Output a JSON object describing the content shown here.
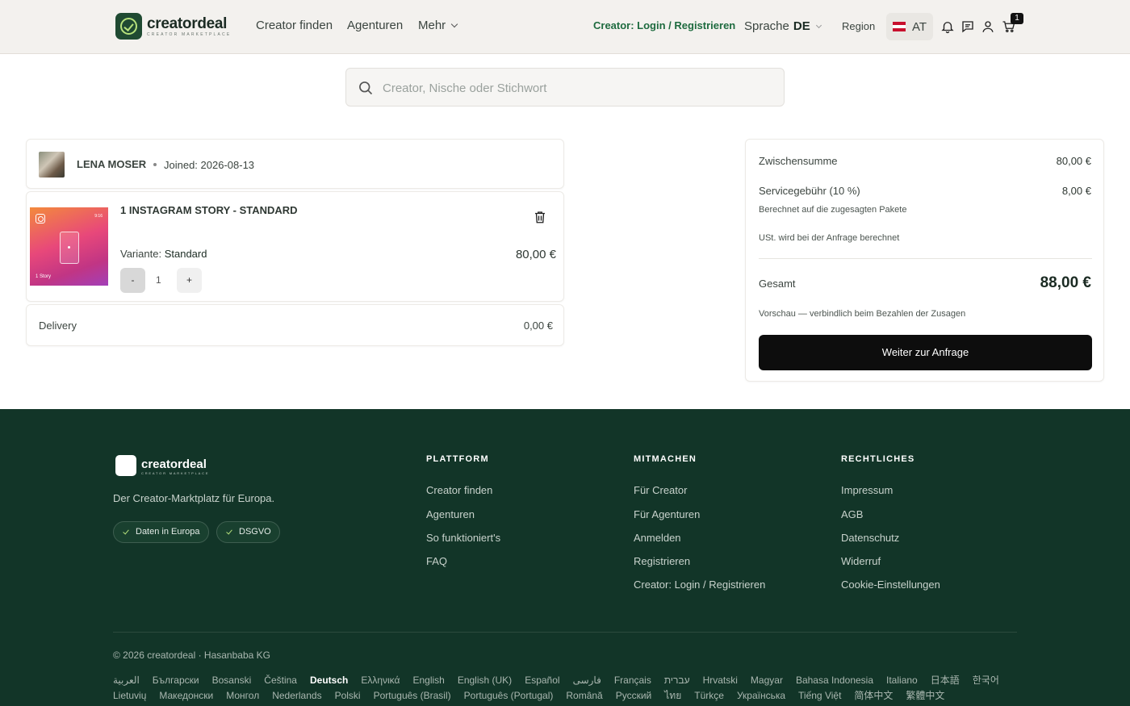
{
  "header": {
    "brand": "creatordeal",
    "brand_sub": "CREATOR MARKETPLACE",
    "nav": [
      "Creator finden",
      "Agenturen",
      "Mehr"
    ],
    "creator_login": "Creator: Login / Registrieren",
    "language_label": "Sprache",
    "language_code": "DE",
    "region_label": "Region",
    "region_code": "AT",
    "cart_count": "1"
  },
  "search": {
    "placeholder": "Creator, Nische oder Stichwort"
  },
  "cart": {
    "creator_name": "LENA MOSER",
    "joined": "Joined: 2026-08-13",
    "item": {
      "title": "1 INSTAGRAM STORY - STANDARD",
      "thumb_ratio": "9:16",
      "thumb_label": "1 Story",
      "variant_label": "Variante:",
      "variant_value": "Standard",
      "price": "80,00 €",
      "quantity": "1",
      "minus": "-",
      "plus": "+"
    },
    "delivery_label": "Delivery",
    "delivery_price": "0,00 €"
  },
  "summary": {
    "subtotal_label": "Zwischensumme",
    "subtotal_value": "80,00 €",
    "fee_label": "Servicegebühr (10 %)",
    "fee_value": "8,00 €",
    "fee_note": "Berechnet auf die zugesagten Pakete",
    "vat_note": "USt. wird bei der Anfrage berechnet",
    "total_label": "Gesamt",
    "total_value": "88,00 €",
    "preview_note": "Vorschau — verbindlich beim Bezahlen der Zusagen",
    "submit": "Weiter zur Anfrage"
  },
  "footer": {
    "brand": "creatordeal",
    "brand_sub": "CREATOR MARKETPLACE",
    "tagline": "Der Creator-Marktplatz für Europa.",
    "badges": [
      "Daten in Europa",
      "DSGVO"
    ],
    "columns": [
      {
        "heading": "PLATTFORM",
        "links": [
          "Creator finden",
          "Agenturen",
          "So funktioniert's",
          "FAQ"
        ]
      },
      {
        "heading": "MITMACHEN",
        "links": [
          "Für Creator",
          "Für Agenturen",
          "Anmelden",
          "Registrieren",
          "Creator: Login / Registrieren"
        ]
      },
      {
        "heading": "RECHTLICHES",
        "links": [
          "Impressum",
          "AGB",
          "Datenschutz",
          "Widerruf",
          "Cookie-Einstellungen"
        ]
      }
    ],
    "copyright": "© 2026 creatordeal · Hasanbaba KG",
    "languages_row1": [
      "العربية",
      "Български",
      "Bosanski",
      "Čeština",
      "Deutsch",
      "Ελληνικά",
      "English",
      "English (UK)",
      "Español",
      "فارسی",
      "Français",
      "עברית",
      "Hrvatski",
      "Magyar",
      "Bahasa Indonesia",
      "Italiano",
      "日本語",
      "한국어"
    ],
    "languages_row2": [
      "Lietuvių",
      "Македонски",
      "Монгол",
      "Nederlands",
      "Polski",
      "Português (Brasil)",
      "Português (Portugal)",
      "Română",
      "Русский",
      "ไทย",
      "Türkçe",
      "Українська",
      "Tiếng Việt",
      "简体中文",
      "繁體中文"
    ],
    "active_language": "Deutsch"
  }
}
